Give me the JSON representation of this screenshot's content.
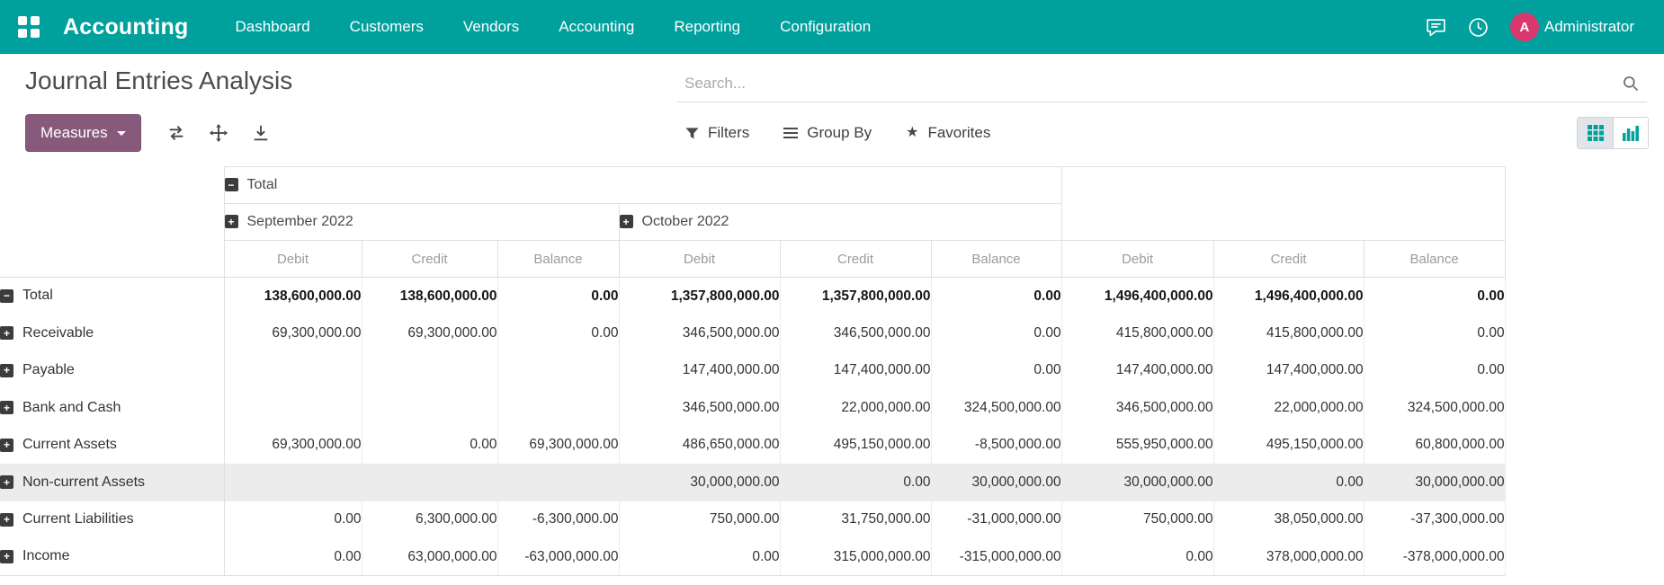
{
  "topbar": {
    "app_name": "Accounting",
    "menu_items": [
      "Dashboard",
      "Customers",
      "Vendors",
      "Accounting",
      "Reporting",
      "Configuration"
    ],
    "user": {
      "initial": "A",
      "name": "Administrator"
    }
  },
  "page": {
    "title": "Journal Entries Analysis"
  },
  "search": {
    "placeholder": "Search..."
  },
  "controls": {
    "measures": "Measures",
    "filters": "Filters",
    "group_by": "Group By",
    "favorites": "Favorites",
    "active_view": "pivot"
  },
  "colors": {
    "topbar": "#00a09d",
    "primary_button": "#875a7b",
    "avatar": "#d9376e",
    "accent": "#00a09d"
  },
  "pivot": {
    "type": "table",
    "col_groups": [
      {
        "label": "Total",
        "expanded": true,
        "children": [
          {
            "label": "September 2022",
            "expanded": false
          },
          {
            "label": "October 2022",
            "expanded": false
          }
        ]
      }
    ],
    "measures": [
      "Debit",
      "Credit",
      "Balance"
    ],
    "rows": [
      {
        "label": "Total",
        "expanded": true,
        "indent": 0,
        "bold": true,
        "highlight": false,
        "values": [
          "138,600,000.00",
          "138,600,000.00",
          "0.00",
          "1,357,800,000.00",
          "1,357,800,000.00",
          "0.00",
          "1,496,400,000.00",
          "1,496,400,000.00",
          "0.00"
        ]
      },
      {
        "label": "Receivable",
        "expanded": false,
        "indent": 1,
        "bold": false,
        "highlight": false,
        "values": [
          "69,300,000.00",
          "69,300,000.00",
          "0.00",
          "346,500,000.00",
          "346,500,000.00",
          "0.00",
          "415,800,000.00",
          "415,800,000.00",
          "0.00"
        ]
      },
      {
        "label": "Payable",
        "expanded": false,
        "indent": 1,
        "bold": false,
        "highlight": false,
        "values": [
          "",
          "",
          "",
          "147,400,000.00",
          "147,400,000.00",
          "0.00",
          "147,400,000.00",
          "147,400,000.00",
          "0.00"
        ]
      },
      {
        "label": "Bank and Cash",
        "expanded": false,
        "indent": 1,
        "bold": false,
        "highlight": false,
        "values": [
          "",
          "",
          "",
          "346,500,000.00",
          "22,000,000.00",
          "324,500,000.00",
          "346,500,000.00",
          "22,000,000.00",
          "324,500,000.00"
        ]
      },
      {
        "label": "Current Assets",
        "expanded": false,
        "indent": 1,
        "bold": false,
        "highlight": false,
        "values": [
          "69,300,000.00",
          "0.00",
          "69,300,000.00",
          "486,650,000.00",
          "495,150,000.00",
          "-8,500,000.00",
          "555,950,000.00",
          "495,150,000.00",
          "60,800,000.00"
        ]
      },
      {
        "label": "Non-current Assets",
        "expanded": false,
        "indent": 1,
        "bold": false,
        "highlight": true,
        "values": [
          "",
          "",
          "",
          "30,000,000.00",
          "0.00",
          "30,000,000.00",
          "30,000,000.00",
          "0.00",
          "30,000,000.00"
        ]
      },
      {
        "label": "Current Liabilities",
        "expanded": false,
        "indent": 1,
        "bold": false,
        "highlight": false,
        "values": [
          "0.00",
          "6,300,000.00",
          "-6,300,000.00",
          "750,000.00",
          "31,750,000.00",
          "-31,000,000.00",
          "750,000.00",
          "38,050,000.00",
          "-37,300,000.00"
        ]
      },
      {
        "label": "Income",
        "expanded": false,
        "indent": 1,
        "bold": false,
        "highlight": false,
        "values": [
          "0.00",
          "63,000,000.00",
          "-63,000,000.00",
          "0.00",
          "315,000,000.00",
          "-315,000,000.00",
          "0.00",
          "378,000,000.00",
          "-378,000,000.00"
        ]
      }
    ]
  }
}
